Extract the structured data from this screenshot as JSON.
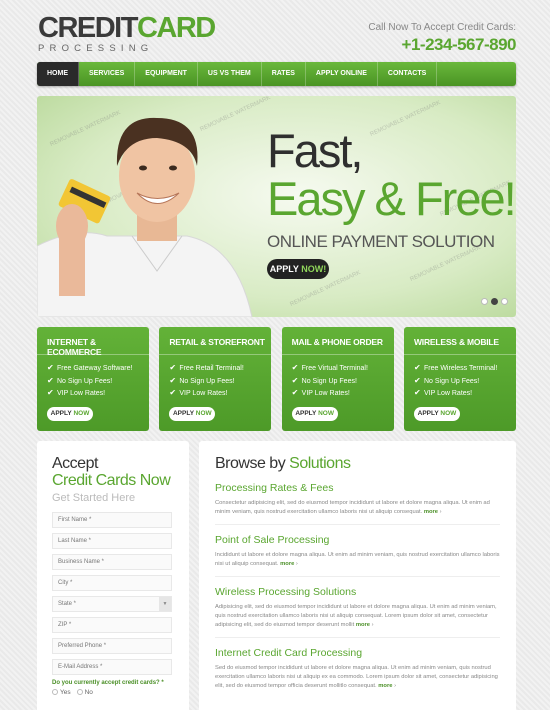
{
  "logo": {
    "main_dark": "CREDIT",
    "main_green": "CARD",
    "sub": "PROCESSING"
  },
  "header": {
    "call_text": "Call Now To Accept Credit Cards:",
    "phone": "+1-234-567-890"
  },
  "nav": [
    "HOME",
    "SERVICES",
    "EQUIPMENT",
    "US VS THEM",
    "RATES",
    "APPLY ONLINE",
    "CONTACTS"
  ],
  "hero": {
    "line1": "Fast,",
    "line2": "Easy & Free!",
    "subtitle": "ONLINE PAYMENT SOLUTION",
    "btn_apply": "APPLY",
    "btn_now": "NOW!",
    "watermark": "REMOVABLE WATERMARK"
  },
  "features": [
    {
      "title": "INTERNET & ECOMMERCE",
      "items": [
        "Free Gateway Software!",
        "No Sign Up Fees!",
        "VIP Low Rates!"
      ]
    },
    {
      "title": "RETAIL & STOREFRONT",
      "items": [
        "Free Retail Terminal!",
        "No Sign Up Fees!",
        "VIP Low Rates!"
      ]
    },
    {
      "title": "MAIL & PHONE ORDER",
      "items": [
        "Free Virtual Terminal!",
        "No Sign Up Fees!",
        "VIP Low Rates!"
      ]
    },
    {
      "title": "WIRELESS & MOBILE",
      "items": [
        "Free Wireless Terminal!",
        "No Sign Up Fees!",
        "VIP Low Rates!"
      ]
    }
  ],
  "feature_btn": {
    "apply": "APPLY",
    "now": "NOW"
  },
  "form": {
    "h1": "Accept",
    "h2": "Credit Cards Now",
    "h3": "Get Started Here",
    "fields": [
      "First Name *",
      "Last Name *",
      "Business Name *",
      "City *",
      "State *",
      "ZIP *",
      "Preferred Phone *",
      "E-Mail Address *"
    ],
    "question": "Do you currently accept credit cards? *",
    "yes": "Yes",
    "no": "No"
  },
  "browse": {
    "title_dark": "Browse by",
    "title_green": "Solutions",
    "more": "more",
    "items": [
      {
        "title": "Processing Rates & Fees",
        "text": "Consectetur adipisicing elit, sed do eiusmod tempor incididunt ut labore et dolore magna aliqua. Ut enim ad minim veniam, quis nostrud exercitation ullamco laboris nisi ut aliquip consequat."
      },
      {
        "title": "Point of Sale Processing",
        "text": "Incididunt ut labore et dolore magna aliqua. Ut enim ad minim veniam, quis nostrud exercitation ullamco laboris nisi ut aliquip consequat."
      },
      {
        "title": "Wireless Processing Solutions",
        "text": "Adipisicing elit, sed do eiusmod tempor incididunt ut labore et dolore magna aliqua. Ut enim ad minim veniam, quis nostrud exercitation ullamco laboris nisi ut aliquip consequat. Lorem ipsum dolor sit amet, consectetur adipisicing elit, sed do eiusmod tempor deserunt mollit"
      },
      {
        "title": "Internet Credit Card Processing",
        "text": "Sed do eiusmod tempor incididunt ut labore et dolore magna aliqua. Ut enim ad minim veniam, quis nostrud exercitation ullamco laboris nisi ut aliquip ex ea commodo. Lorem ipsum dolor sit amet, consectetur adipisicing elit, sed do eiusmod tempor officia deserunt mollitlo consequat."
      }
    ]
  },
  "colors": {
    "brand_green": "#5aa630",
    "dark": "#2a2a2a"
  }
}
